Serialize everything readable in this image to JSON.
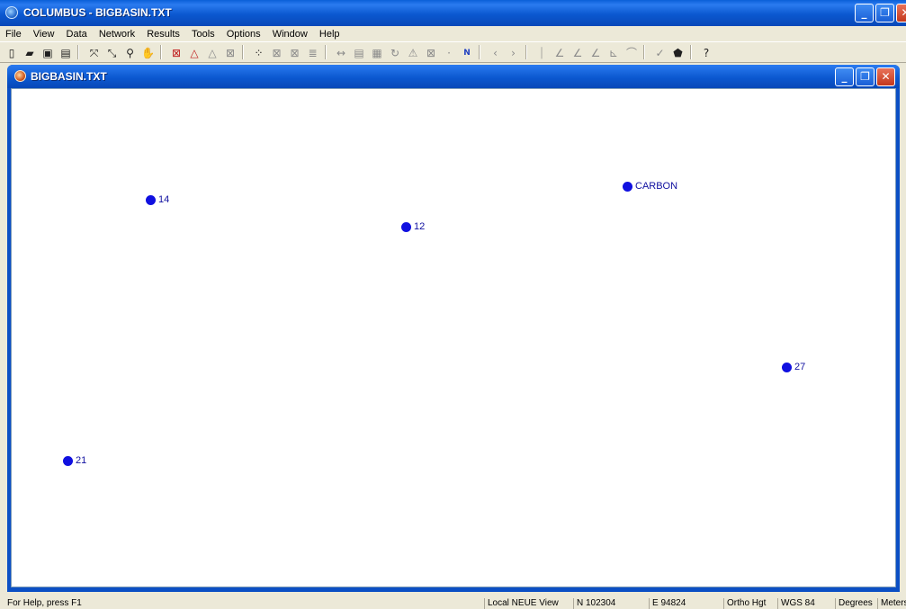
{
  "app": {
    "title": "COLUMBUS - BIGBASIN.TXT",
    "min_glyph": "_",
    "restore_glyph": "❐",
    "close_glyph": "✕"
  },
  "menu": [
    "File",
    "View",
    "Data",
    "Network",
    "Results",
    "Tools",
    "Options",
    "Window",
    "Help"
  ],
  "toolbar": {
    "groups": [
      [
        "new-file-icon",
        "open-folder-icon",
        "save-disk-icon",
        "print-icon"
      ],
      [
        "zoom-extents-icon",
        "zoom-out-icon",
        "zoom-magnify-icon",
        "pan-tool-icon"
      ],
      [
        "error-box-icon",
        "triangle-icon",
        "triangle-dim-icon",
        "box-cross-icon"
      ],
      [
        "network-points-icon",
        "box-cross-2-icon",
        "box-cross-3-icon",
        "stack-icon"
      ],
      [
        "double-arrow-icon",
        "document-icon",
        "notes-icon",
        "rotate-icon",
        "tripod-icon",
        "box-cross-4-icon",
        "precision-icon",
        "north-arrow-icon"
      ],
      [
        "arrow-left-icon",
        "arrow-right-icon"
      ],
      [
        "vertical-line-icon",
        "angle-icon",
        "angle2-icon",
        "angle3-icon",
        "profile-icon",
        "traverse-icon"
      ],
      [
        "check-icon",
        "blob-icon"
      ],
      [
        "context-help-icon"
      ]
    ]
  },
  "child_window": {
    "title": "BIGBASIN.TXT"
  },
  "points": [
    {
      "label": "14"
    },
    {
      "label": "12"
    },
    {
      "label": "CARBON"
    },
    {
      "label": "27"
    },
    {
      "label": "21"
    }
  ],
  "status": {
    "help": "For Help, press F1",
    "view": "Local NEUE View",
    "north": "N 102304",
    "east": "E 94824",
    "height": "Ortho Hgt",
    "datum": "WGS 84",
    "angle_units": "Degrees",
    "linear_units": "Meters"
  },
  "colors": {
    "point": "#1010e0",
    "title_bar": "#0b58d0"
  }
}
